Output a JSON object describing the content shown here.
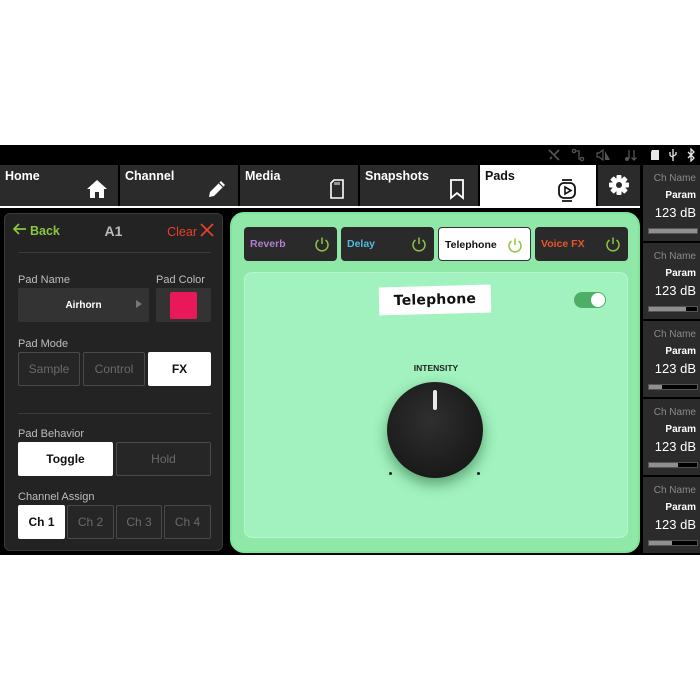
{
  "status_icons": [
    "no-network-icon",
    "routing-icon",
    "mute-speaker-icon",
    "audio-down-icon",
    "sd-card-icon",
    "usb-icon",
    "bluetooth-icon"
  ],
  "nav": {
    "tabs": [
      {
        "label": "Home",
        "icon": "home-icon",
        "active": false
      },
      {
        "label": "Channel",
        "icon": "pencil-icon",
        "active": false
      },
      {
        "label": "Media",
        "icon": "sd-card-icon",
        "active": false
      },
      {
        "label": "Snapshots",
        "icon": "bookmark-icon",
        "active": false
      },
      {
        "label": "Pads",
        "icon": "pad-play-icon",
        "active": true
      }
    ],
    "settings_icon": "gear-icon"
  },
  "pad_editor": {
    "back_label": "Back",
    "pad_id": "A1",
    "clear_label": "Clear",
    "pad_name_label": "Pad Name",
    "pad_name_value": "Airhorn",
    "pad_color_label": "Pad Color",
    "pad_color": "#e8185a",
    "pad_mode_label": "Pad Mode",
    "pad_modes": [
      {
        "label": "Sample",
        "selected": false
      },
      {
        "label": "Control",
        "selected": false
      },
      {
        "label": "FX",
        "selected": true
      }
    ],
    "pad_behavior_label": "Pad Behavior",
    "pad_behaviors": [
      {
        "label": "Toggle",
        "selected": true
      },
      {
        "label": "Hold",
        "selected": false
      }
    ],
    "channel_assign_label": "Channel Assign",
    "channels": [
      {
        "label": "Ch 1",
        "selected": true
      },
      {
        "label": "Ch 2",
        "selected": false
      },
      {
        "label": "Ch 3",
        "selected": false
      },
      {
        "label": "Ch 4",
        "selected": false
      }
    ]
  },
  "fx": {
    "tabs": [
      {
        "label": "Reverb",
        "color": "#b07fcf",
        "selected": false
      },
      {
        "label": "Delay",
        "color": "#52b8e0",
        "selected": false
      },
      {
        "label": "Telephone",
        "color": "#111111",
        "selected": true
      },
      {
        "label": "Voice FX",
        "color": "#e8552c",
        "selected": false
      }
    ],
    "power_icon_color": "#8cc63f",
    "title": "Telephone",
    "enabled": true,
    "intensity_label": "INTENSITY"
  },
  "channels_strip": [
    {
      "name": "Ch Name",
      "param": "Param",
      "value": "123 dB",
      "level": 1.0
    },
    {
      "name": "Ch Name",
      "param": "Param",
      "value": "123 dB",
      "level": 0.78
    },
    {
      "name": "Ch Name",
      "param": "Param",
      "value": "123 dB",
      "level": 0.28
    },
    {
      "name": "Ch Name",
      "param": "Param",
      "value": "123 dB",
      "level": 0.6
    },
    {
      "name": "Ch Name",
      "param": "Param",
      "value": "123 dB",
      "level": 0.48
    }
  ]
}
